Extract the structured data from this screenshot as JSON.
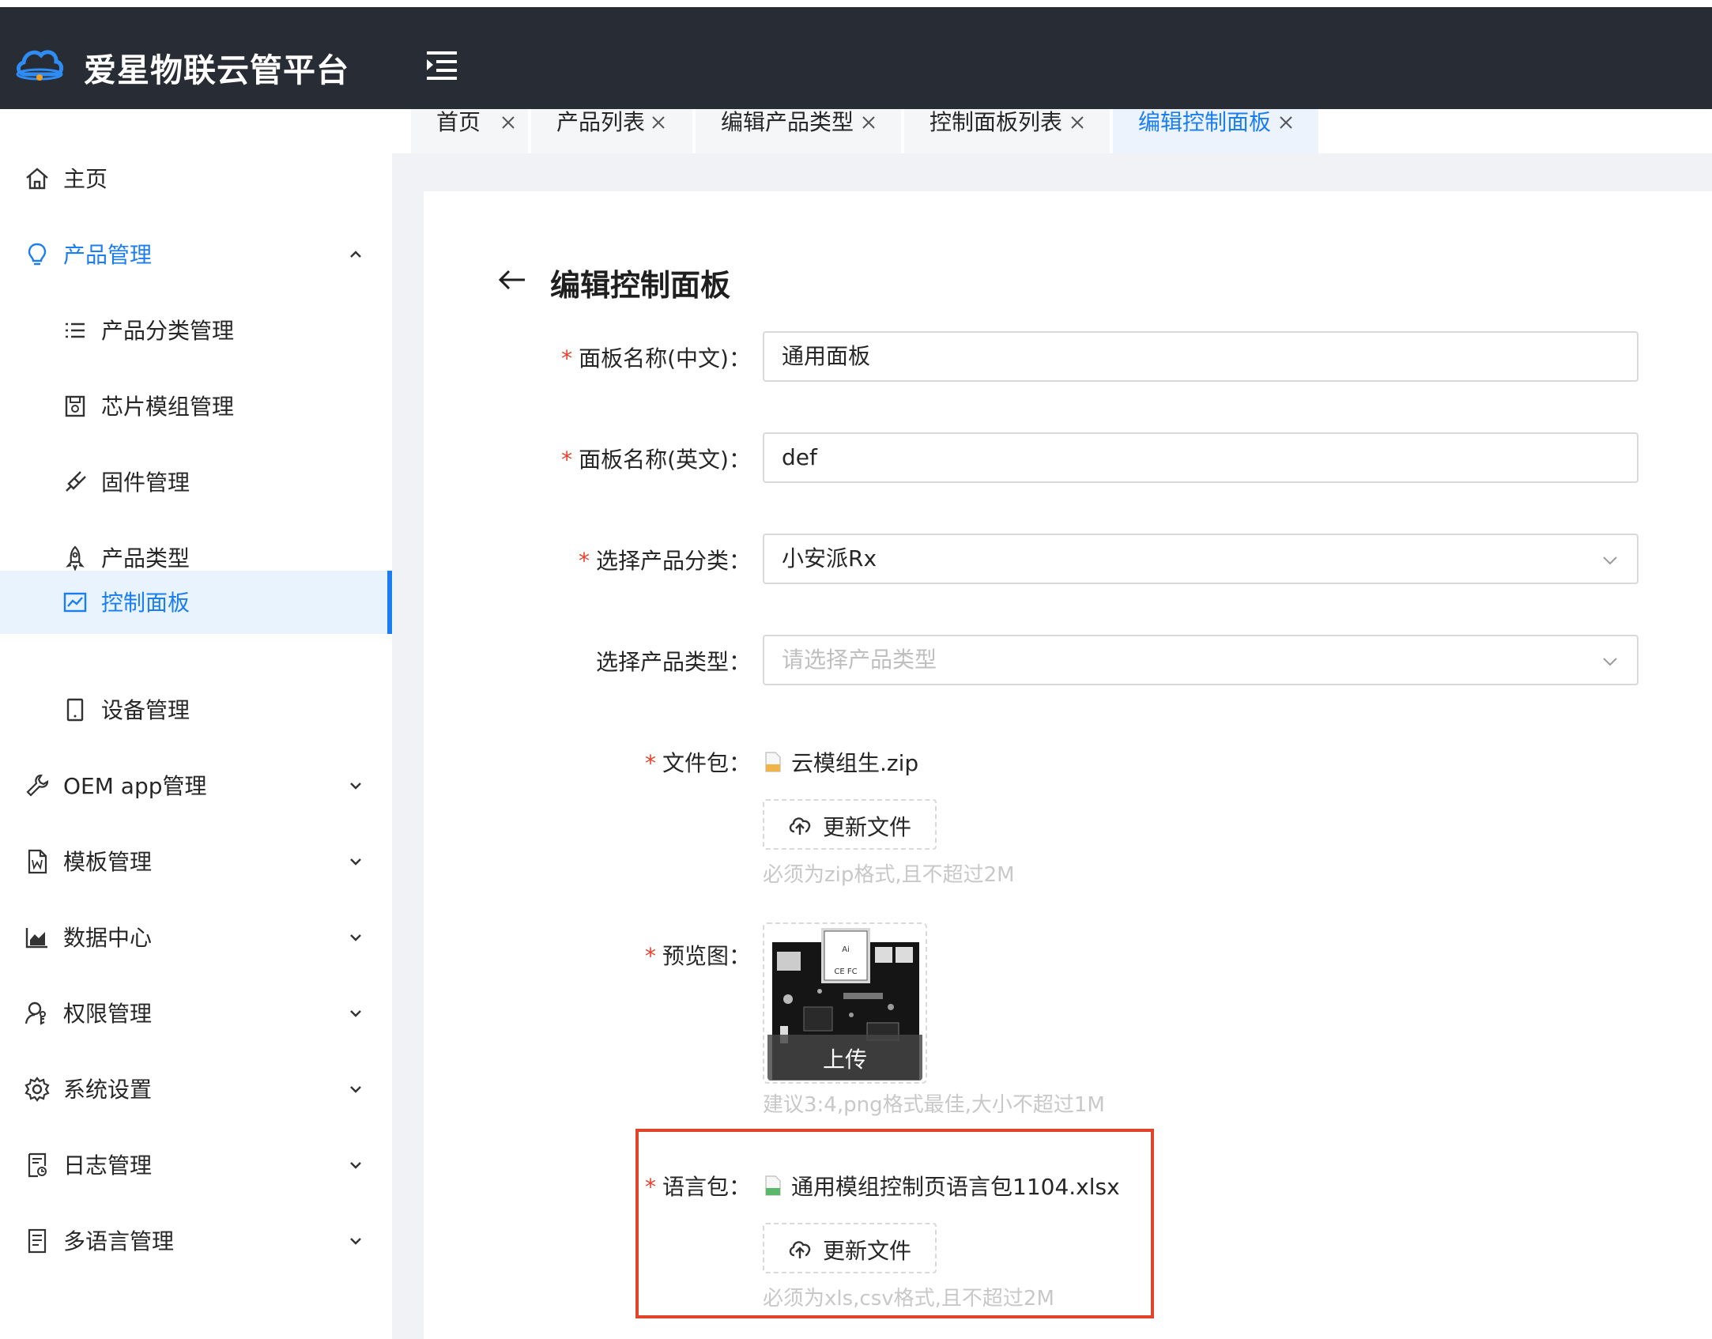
{
  "app": {
    "title": "爱星物联云管平台"
  },
  "sidebar": {
    "items": [
      {
        "label": "主页",
        "icon": "home-icon"
      },
      {
        "label": "产品管理",
        "icon": "bulb-icon",
        "expanded": true
      },
      {
        "label": "产品分类管理",
        "icon": "list-icon"
      },
      {
        "label": "芯片模组管理",
        "icon": "chip-icon"
      },
      {
        "label": "固件管理",
        "icon": "plug-icon"
      },
      {
        "label": "产品类型",
        "icon": "rocket-icon"
      },
      {
        "label": "控制面板",
        "icon": "chart-icon",
        "active": true
      },
      {
        "label": "设备管理",
        "icon": "tablet-icon"
      },
      {
        "label": "OEM app管理",
        "icon": "wrench-icon"
      },
      {
        "label": "模板管理",
        "icon": "word-file-icon"
      },
      {
        "label": "数据中心",
        "icon": "area-chart-icon"
      },
      {
        "label": "权限管理",
        "icon": "user-key-icon"
      },
      {
        "label": "系统设置",
        "icon": "gear-icon"
      },
      {
        "label": "日志管理",
        "icon": "log-icon"
      },
      {
        "label": "多语言管理",
        "icon": "doc-list-icon"
      }
    ]
  },
  "tabs": [
    {
      "label": "首页"
    },
    {
      "label": "产品列表"
    },
    {
      "label": "编辑产品类型"
    },
    {
      "label": "控制面板列表"
    },
    {
      "label": "编辑控制面板",
      "active": true
    }
  ],
  "page": {
    "title": "编辑控制面板"
  },
  "form": {
    "name_cn": {
      "label": "面板名称(中文)",
      "value": "通用面板"
    },
    "name_en": {
      "label": "面板名称(英文)",
      "value": "def"
    },
    "category": {
      "label": "选择产品分类",
      "value": "小安派Rx"
    },
    "type": {
      "label": "选择产品类型",
      "placeholder": "请选择产品类型"
    },
    "file_package": {
      "label": "文件包",
      "file_name": "云模组生.zip",
      "button_label": "更新文件",
      "hint": "必须为zip格式,且不超过2M"
    },
    "preview": {
      "label": "预览图",
      "overlay_label": "上传",
      "hint": "建议3:4,png格式最佳,大小不超过1M"
    },
    "language_package": {
      "label": "语言包",
      "file_name": "通用模组控制页语言包1104.xlsx",
      "button_label": "更新文件",
      "hint": "必须为xls,csv格式,且不超过2M"
    },
    "colon": "："
  },
  "colors": {
    "accent": "#1a7ef0",
    "header_bg": "#282c35",
    "required": "#e8402c",
    "highlight": "#e0452c"
  }
}
